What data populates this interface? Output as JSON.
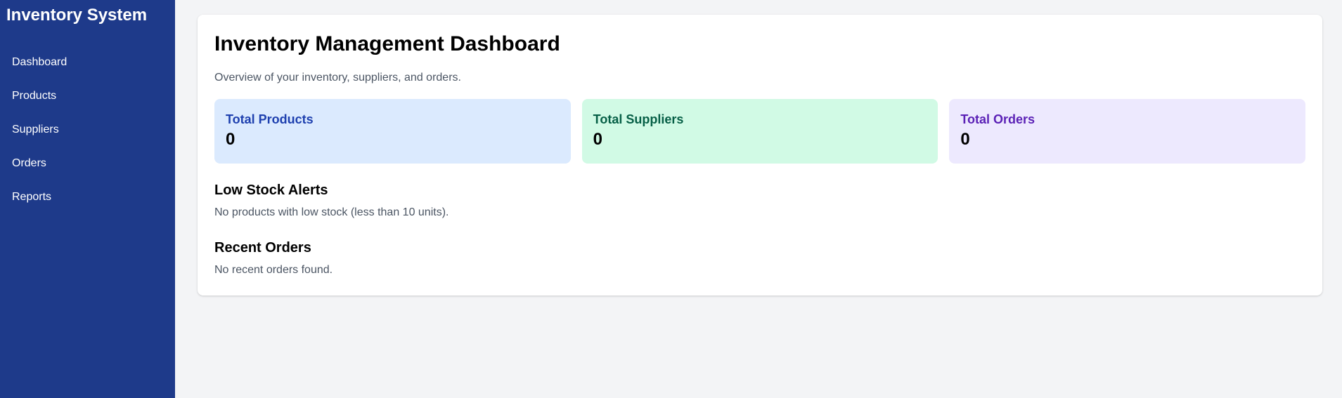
{
  "sidebar": {
    "brand": "Inventory System",
    "items": [
      {
        "label": "Dashboard"
      },
      {
        "label": "Products"
      },
      {
        "label": "Suppliers"
      },
      {
        "label": "Orders"
      },
      {
        "label": "Reports"
      }
    ]
  },
  "main": {
    "title": "Inventory Management Dashboard",
    "subtitle": "Overview of your inventory, suppliers, and orders.",
    "stats": [
      {
        "label": "Total Products",
        "value": "0",
        "color": "#1e40af",
        "background": "#dbeafe"
      },
      {
        "label": "Total Suppliers",
        "value": "0",
        "color": "#065f46",
        "background": "#d1fae5"
      },
      {
        "label": "Total Orders",
        "value": "0",
        "color": "#5b21b6",
        "background": "#ede9fe"
      }
    ],
    "low_stock": {
      "title": "Low Stock Alerts",
      "message": "No products with low stock (less than 10 units)."
    },
    "recent_orders": {
      "title": "Recent Orders",
      "message": "No recent orders found."
    }
  },
  "colors": {
    "sidebar_bg": "#1e3a8a",
    "page_bg": "#f3f4f6",
    "card_bg": "#ffffff",
    "muted_text": "#4b5563"
  }
}
